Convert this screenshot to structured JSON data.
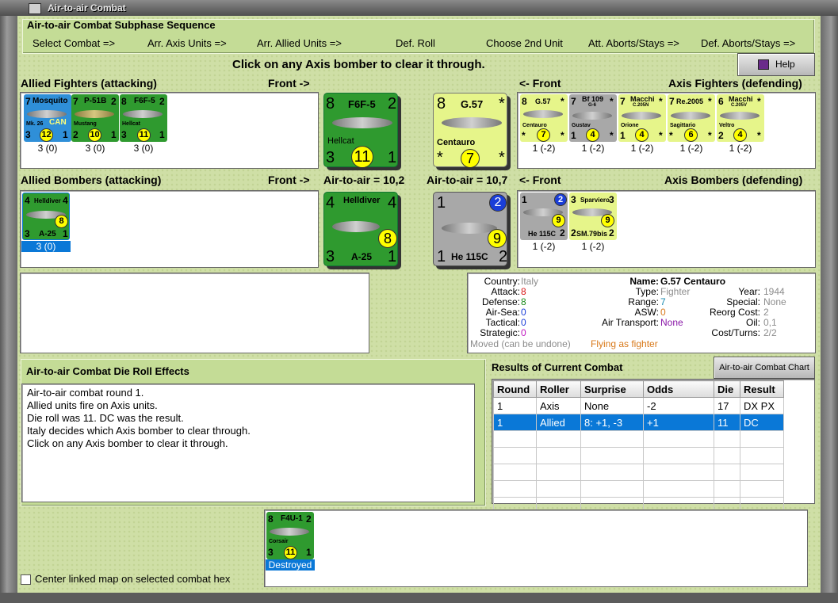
{
  "window": {
    "title": "Air-to-air Combat"
  },
  "sequence": {
    "heading": "Air-to-air Combat Subphase Sequence",
    "steps": [
      "Select Combat =>",
      "Arr. Axis Units =>",
      "Arr. Allied Units =>",
      "Def. Roll",
      "Choose 2nd Unit",
      "Att. Aborts/Stays =>",
      "Def. Aborts/Stays =>"
    ]
  },
  "instruction": "Click on any Axis bomber to clear it through.",
  "help_button": "Help",
  "allied_fighters": {
    "label": "Allied Fighters (attacking)",
    "front": "Front ->",
    "units": [
      {
        "name": "Mosquito",
        "top_left": "7",
        "top_right": "",
        "sub": "Mk. 26",
        "extra": "CAN",
        "bottom_left": "3",
        "coin": "12",
        "bottom_right": "1",
        "caption": "3 (0)",
        "color": "#2f8fd8"
      },
      {
        "name": "P-51B",
        "top_left": "7",
        "top_right": "2",
        "sub": "Mustang",
        "extra": "",
        "bottom_left": "2",
        "coin": "10",
        "bottom_right": "1",
        "caption": "3 (0)",
        "color": "#2f9a2f"
      },
      {
        "name": "F6F-5",
        "top_left": "8",
        "top_right": "2",
        "sub": "Hellcat",
        "extra": "",
        "bottom_left": "3",
        "coin": "11",
        "bottom_right": "1",
        "caption": "3 (0)",
        "color": "#2f9a2f"
      }
    ]
  },
  "axis_fighters": {
    "label": "Axis Fighters (defending)",
    "front": "<- Front",
    "units": [
      {
        "name": "G.57",
        "sub2": "",
        "top_left": "8",
        "top_right": "*",
        "sub": "Centauro",
        "bottom_left": "*",
        "coin": "7",
        "bottom_right": "*",
        "caption": "1 (-2)",
        "color": "#e6f58a"
      },
      {
        "name": "Bf 109",
        "sub2": "G-6",
        "top_left": "7",
        "top_right": "*",
        "sub": "Gustav",
        "bottom_left": "1",
        "coin": "4",
        "bottom_right": "*",
        "caption": "1 (-2)",
        "color": "#a8a8a8"
      },
      {
        "name": "Macchi",
        "sub2": "C.205N",
        "top_left": "7",
        "top_right": "*",
        "sub": "Orione",
        "bottom_left": "1",
        "coin": "4",
        "bottom_right": "*",
        "caption": "1 (-2)",
        "color": "#e6f58a"
      },
      {
        "name": "Re.2005",
        "sub2": "",
        "top_left": "7",
        "top_right": "*",
        "sub": "Sagittario",
        "bottom_left": "*",
        "coin": "6",
        "bottom_right": "*",
        "caption": "1 (-2)",
        "color": "#e6f58a"
      },
      {
        "name": "Macchi",
        "sub2": "C.205V",
        "top_left": "6",
        "top_right": "*",
        "sub": "Veltro",
        "bottom_left": "2",
        "coin": "4",
        "bottom_right": "*",
        "caption": "1 (-2)",
        "color": "#e6f58a"
      }
    ]
  },
  "allied_bombers": {
    "label": "Allied Bombers (attacking)",
    "front": "Front ->",
    "units": [
      {
        "name": "Helldiver",
        "top_left": "4",
        "top_right": "4",
        "sub": "A-25",
        "bottom_left": "3",
        "coin": "8",
        "bottom_right": "1",
        "caption": "3 (0)",
        "color": "#2f9a2f"
      }
    ]
  },
  "axis_bombers": {
    "label": "Axis Bombers (defending)",
    "front": "<- Front",
    "units": [
      {
        "name": "He 115C",
        "top_left": "1",
        "top_right": "2",
        "coin": "9",
        "bottom_right": "2",
        "caption": "1 (-2)",
        "color": "#a8a8a8"
      },
      {
        "name": "Sparviero",
        "sub": "SM.79bis",
        "top_left": "3",
        "top_right": "3",
        "coin": "9",
        "bottom_left": "2",
        "bottom_right": "2",
        "caption": "1 (-2)",
        "color": "#e6f58a"
      }
    ]
  },
  "big_allied_fighter": {
    "name": "F6F-5",
    "sub": "Hellcat",
    "top_left": "8",
    "top_right": "2",
    "bottom_left": "3",
    "coin": "11",
    "bottom_right": "1"
  },
  "big_axis_fighter": {
    "name": "G.57",
    "sub": "Centauro",
    "top_left": "8",
    "top_right": "*",
    "bottom_left": "*",
    "coin": "7",
    "bottom_right": "*"
  },
  "big_allied_bomber": {
    "name": "Helldiver",
    "sub": "A-25",
    "top_left": "4",
    "top_right": "4",
    "bottom_left": "3",
    "coin": "8",
    "bottom_right": "1",
    "a2a": "Air-to-air = 10,2"
  },
  "big_axis_bomber": {
    "name": "He 115C",
    "top_left": "1",
    "top_right": "2",
    "bottom_left": "1",
    "coin": "9",
    "bottom_right": "2",
    "a2a": "Air-to-air = 10,7"
  },
  "unit_info": {
    "country_label": "Country:",
    "country": "Italy",
    "attack_label": "Attack:",
    "attack": "8",
    "defense_label": "Defense:",
    "defense": "8",
    "airsea_label": "Air-Sea:",
    "airsea": "0",
    "tactical_label": "Tactical:",
    "tactical": "0",
    "strategic_label": "Strategic:",
    "strategic": "0",
    "name_label": "Name:",
    "name": "G.57 Centauro",
    "type_label": "Type:",
    "type": "Fighter",
    "range_label": "Range:",
    "range": "7",
    "asw_label": "ASW:",
    "asw": "0",
    "airtransport_label": "Air Transport:",
    "airtransport": "None",
    "year_label": "Year:",
    "year": "1944",
    "special_label": "Special:",
    "special": "None",
    "reorg_label": "Reorg Cost:",
    "reorg": "2",
    "oil_label": "Oil:",
    "oil": "0,1",
    "costturns_label": "Cost/Turns:",
    "costturns": "2/2",
    "moved": "Moved (can be undone)",
    "flying": "Flying as fighter"
  },
  "die_roll": {
    "heading": "Air-to-air Combat Die Roll Effects",
    "lines": [
      "Air-to-air combat round 1.",
      "Allied units fire on Axis units.",
      "Die roll was 11.  DC was the result.",
      "Italy decides which Axis bomber to clear through.",
      "Click on any Axis bomber to clear it through."
    ]
  },
  "results": {
    "heading": "Results of Current Combat",
    "chart_button": "Air-to-air Combat Chart",
    "columns": [
      "Round",
      "Roller",
      "Surprise",
      "Odds",
      "Die",
      "Result"
    ],
    "rows": [
      [
        "1",
        "Axis",
        "None",
        "-2",
        "17",
        "DX PX"
      ],
      [
        "1",
        "Allied",
        "8: +1, -3",
        "+1",
        "11",
        "DC"
      ]
    ]
  },
  "destroyed_unit": {
    "name": "F4U-1",
    "top_left": "8",
    "top_right": "2",
    "sub": "Corsair",
    "bottom_left": "3",
    "coin": "11",
    "bottom_right": "1",
    "caption": "Destroyed"
  },
  "center_map_checkbox": "Center linked map on selected combat hex",
  "colors": {
    "allied_green": "#2f9a2f",
    "axis_yellow": "#e6f58a",
    "axis_grey": "#a8a8a8",
    "selection_blue": "#0a78d7",
    "panel_bg": "#cfdfa6"
  }
}
